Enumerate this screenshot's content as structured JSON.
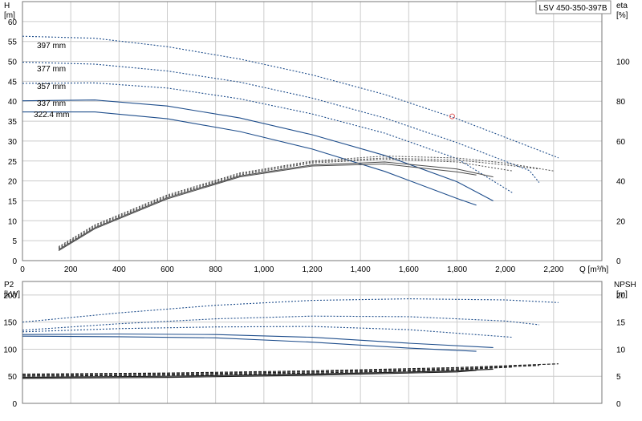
{
  "model_label": "LSV 450-350-397B",
  "colors": {
    "curve": "#1f4e8c",
    "eff": "#4a4a4a",
    "npsh": "#222222",
    "grid": "#cccccc",
    "marker": "#e06060"
  },
  "chart_data": [
    {
      "type": "line",
      "title": "",
      "xlabel": "Q [m³/h]",
      "ylabel": "H\n[m]",
      "y2label": "eta\n[%]",
      "xlim": [
        0,
        2400
      ],
      "ylim": [
        0,
        65
      ],
      "y2lim": [
        0,
        130
      ],
      "xticks": [
        "0",
        "200",
        "400",
        "600",
        "800",
        "1,000",
        "1,200",
        "1,400",
        "1,600",
        "1,800",
        "2,000",
        "2,200"
      ],
      "yticks": [
        "0",
        "5",
        "10",
        "15",
        "20",
        "25",
        "30",
        "35",
        "40",
        "45",
        "50",
        "55",
        "60"
      ],
      "y2ticks": [
        "0",
        "20",
        "40",
        "60",
        "80",
        "100"
      ],
      "grid": true,
      "series": [
        {
          "name": "397 mm",
          "style": "dotted",
          "x": [
            0,
            300,
            600,
            900,
            1200,
            1500,
            1800,
            2100,
            2220
          ],
          "y": [
            56.3,
            55.8,
            53.7,
            50.6,
            46.6,
            41.7,
            35.6,
            28.6,
            25.8
          ]
        },
        {
          "name": "377 mm",
          "style": "dotted",
          "x": [
            0,
            300,
            600,
            900,
            1200,
            1500,
            1800,
            2100,
            2140
          ],
          "y": [
            49.8,
            49.3,
            47.6,
            44.8,
            40.8,
            35.8,
            29.6,
            22.6,
            19.6
          ]
        },
        {
          "name": "357 mm",
          "style": "dotted",
          "x": [
            0,
            300,
            600,
            900,
            1200,
            1500,
            1800,
            2030
          ],
          "y": [
            44.5,
            44.6,
            43.3,
            40.6,
            36.8,
            32.0,
            25.6,
            17.0
          ]
        },
        {
          "name": "337 mm",
          "style": "solid",
          "x": [
            0,
            300,
            600,
            900,
            1200,
            1500,
            1800,
            1950
          ],
          "y": [
            40.1,
            40.3,
            38.8,
            35.8,
            31.6,
            26.4,
            19.8,
            15.0
          ]
        },
        {
          "name": "322.4 mm",
          "style": "solid",
          "x": [
            0,
            300,
            600,
            900,
            1200,
            1500,
            1800,
            1880
          ],
          "y": [
            37.3,
            37.3,
            35.6,
            32.4,
            28.0,
            22.4,
            15.6,
            13.9
          ]
        }
      ],
      "efficiency_series": [
        {
          "x": [
            150,
            300,
            600,
            900,
            1200,
            1500,
            1800,
            2000,
            2200
          ],
          "y": [
            7,
            18,
            33,
            44,
            50,
            52.5,
            51.5,
            49,
            45
          ]
        },
        {
          "x": [
            150,
            300,
            600,
            900,
            1200,
            1500,
            1800,
            2000,
            2140
          ],
          "y": [
            6.5,
            17.5,
            32.5,
            43.5,
            49.5,
            51.5,
            50.5,
            48,
            46
          ]
        },
        {
          "x": [
            150,
            300,
            600,
            900,
            1200,
            1500,
            1800,
            2030
          ],
          "y": [
            6,
            17,
            32,
            43,
            49,
            51,
            49.5,
            45
          ]
        },
        {
          "x": [
            150,
            300,
            600,
            900,
            1200,
            1500,
            1800,
            1950
          ],
          "y": [
            5.5,
            16.5,
            31.5,
            42.5,
            48,
            49.5,
            46,
            42
          ]
        },
        {
          "x": [
            150,
            300,
            600,
            900,
            1200,
            1500,
            1800,
            1880
          ],
          "y": [
            5,
            16,
            31,
            42,
            47.5,
            48.5,
            44.5,
            43
          ]
        }
      ],
      "marker": {
        "x": 1780,
        "y": 36.2
      }
    },
    {
      "type": "line",
      "title": "",
      "xlabel": "",
      "ylabel": "P2\n[kW]",
      "y2label": "NPSH\n[m]",
      "xlim": [
        0,
        2400
      ],
      "ylim": [
        0,
        225
      ],
      "y2lim": [
        0,
        22.5
      ],
      "yticks": [
        "0",
        "50",
        "100",
        "150",
        "200"
      ],
      "y2ticks": [
        "0",
        "5",
        "10",
        "15",
        "20"
      ],
      "grid": true,
      "series": [
        {
          "name": "397 mm",
          "style": "dotted",
          "x": [
            0,
            400,
            800,
            1200,
            1600,
            2000,
            2220
          ],
          "y": [
            150,
            167,
            181,
            190,
            193,
            191,
            186
          ]
        },
        {
          "name": "377 mm",
          "style": "dotted",
          "x": [
            0,
            400,
            800,
            1200,
            1600,
            2000,
            2140
          ],
          "y": [
            135,
            147,
            156,
            161,
            160,
            152,
            145
          ]
        },
        {
          "name": "357 mm",
          "style": "dotted",
          "x": [
            0,
            400,
            800,
            1200,
            1600,
            2030
          ],
          "y": [
            132,
            138,
            141,
            142,
            136,
            122
          ]
        },
        {
          "name": "337 mm",
          "style": "solid",
          "x": [
            0,
            400,
            800,
            1200,
            1600,
            1950
          ],
          "y": [
            127,
            128,
            127,
            122,
            111,
            103
          ]
        },
        {
          "name": "322.4 mm",
          "style": "solid",
          "x": [
            0,
            400,
            800,
            1200,
            1600,
            1880
          ],
          "y": [
            124,
            123,
            121,
            113,
            102,
            96
          ]
        }
      ],
      "npsh_series": [
        {
          "x": [
            0,
            600,
            1200,
            1800,
            2220
          ],
          "y": [
            5.4,
            5.6,
            6.0,
            6.6,
            7.3
          ]
        },
        {
          "x": [
            0,
            600,
            1200,
            1800,
            2140
          ],
          "y": [
            5.2,
            5.4,
            5.8,
            6.4,
            7.0
          ]
        },
        {
          "x": [
            0,
            600,
            1200,
            1800,
            2030
          ],
          "y": [
            5.0,
            5.2,
            5.6,
            6.2,
            6.7
          ]
        },
        {
          "x": [
            0,
            600,
            1200,
            1800,
            1950
          ],
          "y": [
            4.8,
            5.0,
            5.4,
            6.0,
            6.3
          ]
        },
        {
          "x": [
            0,
            600,
            1200,
            1800,
            1880
          ],
          "y": [
            4.6,
            4.8,
            5.2,
            5.8,
            6.1
          ]
        }
      ]
    }
  ]
}
